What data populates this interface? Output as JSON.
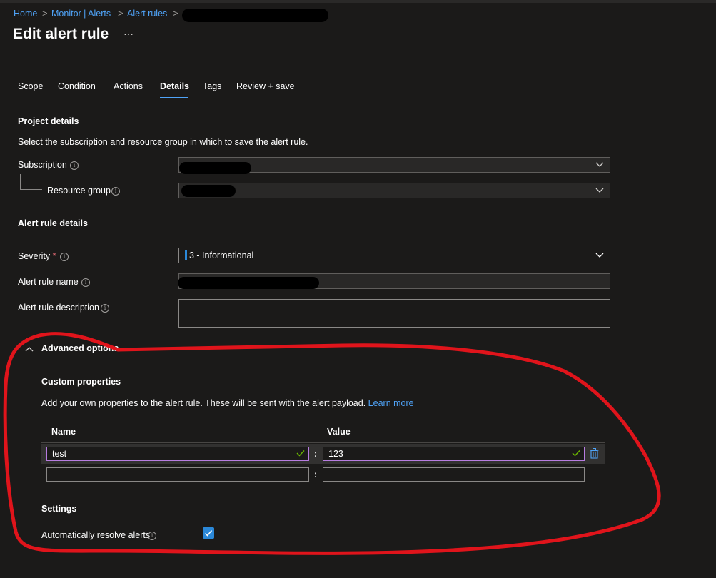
{
  "breadcrumb": {
    "items": [
      "Home",
      "Monitor | Alerts",
      "Alert rules"
    ],
    "separator": ">"
  },
  "page": {
    "title": "Edit alert rule",
    "more_label": "···"
  },
  "tabs": [
    {
      "label": "Scope",
      "active": false
    },
    {
      "label": "Condition",
      "active": false
    },
    {
      "label": "Actions",
      "active": false
    },
    {
      "label": "Details",
      "active": true
    },
    {
      "label": "Tags",
      "active": false
    },
    {
      "label": "Review + save",
      "active": false
    }
  ],
  "project_details": {
    "heading": "Project details",
    "description": "Select the subscription and resource group in which to save the alert rule.",
    "subscription_label": "Subscription",
    "resource_group_label": "Resource group"
  },
  "alert_rule_details": {
    "heading": "Alert rule details",
    "severity_label": "Severity",
    "required_mark": "*",
    "severity_value": "3 - Informational",
    "name_label": "Alert rule name",
    "description_label": "Alert rule description"
  },
  "advanced": {
    "toggle_label": "Advanced options",
    "expanded": true,
    "custom_properties_heading": "Custom properties",
    "custom_properties_text": "Add your own properties to the alert rule. These will be sent with the alert payload.",
    "learn_more": "Learn more",
    "columns": [
      "Name",
      "Value"
    ],
    "separator": ":",
    "rows": [
      {
        "name": "test",
        "value": "123",
        "valid": true
      },
      {
        "name": "",
        "value": "",
        "valid": false
      }
    ],
    "settings_heading": "Settings",
    "auto_resolve_label": "Automatically resolve alerts",
    "auto_resolve_checked": true
  },
  "icons": {
    "info": "info-icon",
    "chevron": "chevron-down-icon",
    "collapse": "chevron-up-icon",
    "valid": "checkmark-icon",
    "delete": "trash-icon"
  },
  "colors": {
    "accent": "#4fa3f7",
    "annotation": "#e0141b",
    "severity_bar": "#2b88d8",
    "valid": "#6bb700",
    "selected_border": "#b77ce0"
  }
}
